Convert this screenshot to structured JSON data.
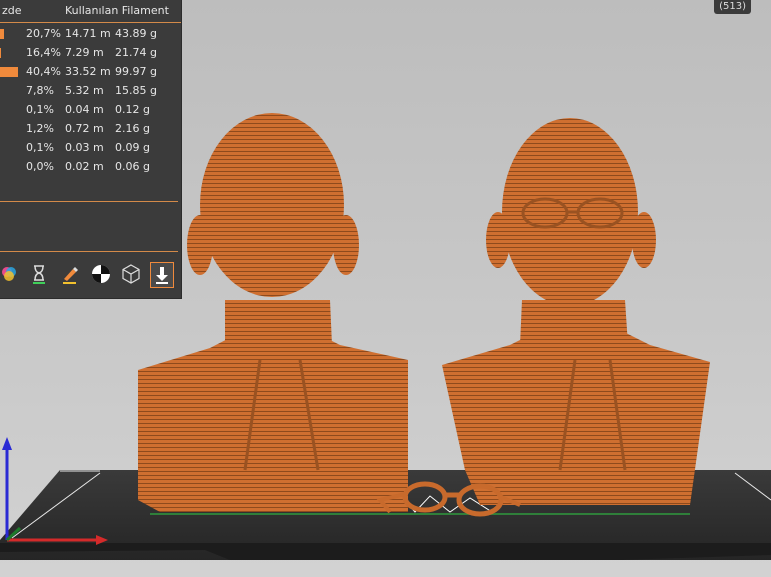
{
  "stats": {
    "header": {
      "percent_label": "zde",
      "filament_label": "Kullanılan Filament"
    },
    "rows": [
      {
        "percent": "20,7%",
        "length": "14.71 m",
        "weight": "43.89 g",
        "bar_fraction": 0.2
      },
      {
        "percent": "16,4%",
        "length": "7.29 m",
        "weight": "21.74 g",
        "bar_fraction": 0.06
      },
      {
        "percent": "40,4%",
        "length": "33.52 m",
        "weight": "99.97 g",
        "bar_fraction": 1.0
      },
      {
        "percent": "7,8%",
        "length": "5.32 m",
        "weight": "15.85 g",
        "bar_fraction": 0
      },
      {
        "percent": "0,1%",
        "length": "0.04 m",
        "weight": "0.12 g",
        "bar_fraction": 0
      },
      {
        "percent": "1,2%",
        "length": "0.72 m",
        "weight": "2.16 g",
        "bar_fraction": 0
      },
      {
        "percent": "0,1%",
        "length": "0.03 m",
        "weight": "0.09 g",
        "bar_fraction": 0
      },
      {
        "percent": "0,0%",
        "length": "0.02 m",
        "weight": "0.06 g",
        "bar_fraction": 0
      }
    ],
    "swatch_color": "#f08a3c"
  },
  "toolbar": {
    "icons": [
      "color-palette-icon",
      "hourglass-icon",
      "brush-icon",
      "balance-icon",
      "wireframe-cube-icon",
      "export-download-icon"
    ]
  },
  "layer_badge": {
    "label": "(513)"
  },
  "scene": {
    "model_color": "#c86a2c",
    "bed_color": "#2f2f2f",
    "axis_colors": {
      "x": "#d42a2a",
      "y": "#1d7a2a",
      "z": "#2a2ad4"
    }
  }
}
